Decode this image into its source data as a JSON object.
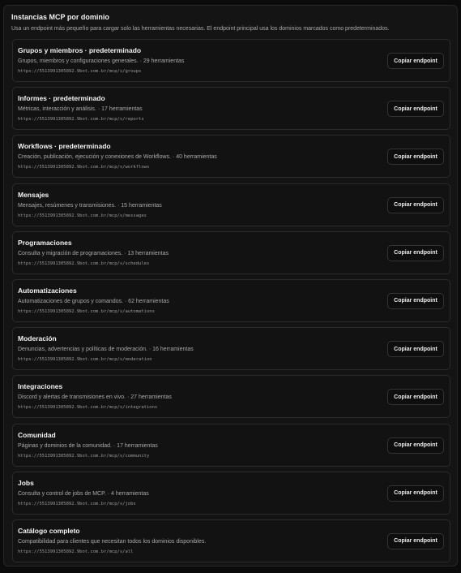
{
  "panel": {
    "title": "Instancias MCP por dominio",
    "subtitle": "Usa un endpoint más pequeño para cargar solo las herramientas necesarias. El endpoint principal usa los dominios marcados como predeterminados."
  },
  "copy_label": "Copiar endpoint",
  "instances": [
    {
      "title": "Grupos y miembros · predeterminado",
      "desc": "Grupos, miembros y configuraciones generales. · 29 herramientas",
      "url": "https://5513991305892.9bot.com.br/mcp/s/groups"
    },
    {
      "title": "Informes · predeterminado",
      "desc": "Métricas, interacción y análisis. · 17 herramientas",
      "url": "https://5513991305892.9bot.com.br/mcp/s/reports"
    },
    {
      "title": "Workflows · predeterminado",
      "desc": "Creación, publicación, ejecución y conexiones de Workflows. · 40 herramientas",
      "url": "https://5513991305892.9bot.com.br/mcp/s/workflows"
    },
    {
      "title": "Mensajes",
      "desc": "Mensajes, resúmenes y transmisiones. · 15 herramientas",
      "url": "https://5513991305892.9bot.com.br/mcp/s/messages"
    },
    {
      "title": "Programaciones",
      "desc": "Consulta y migración de programaciones. · 13 herramientas",
      "url": "https://5513991305892.9bot.com.br/mcp/s/schedules"
    },
    {
      "title": "Automatizaciones",
      "desc": "Automatizaciones de grupos y comandos. · 62 herramientas",
      "url": "https://5513991305892.9bot.com.br/mcp/s/automations"
    },
    {
      "title": "Moderación",
      "desc": "Denuncias, advertencias y políticas de moderación. · 16 herramientas",
      "url": "https://5513991305892.9bot.com.br/mcp/s/moderation"
    },
    {
      "title": "Integraciones",
      "desc": "Discord y alertas de transmisiones en vivo. · 27 herramientas",
      "url": "https://5513991305892.9bot.com.br/mcp/s/integrations"
    },
    {
      "title": "Comunidad",
      "desc": "Páginas y dominios de la comunidad. · 17 herramientas",
      "url": "https://5513991305892.9bot.com.br/mcp/s/community"
    },
    {
      "title": "Jobs",
      "desc": "Consulta y control de jobs de MCP. · 4 herramientas",
      "url": "https://5513991305892.9bot.com.br/mcp/s/jobs"
    },
    {
      "title": "Catálogo completo",
      "desc": "Compatibilidad para clientes que necesitan todos los dominios disponibles.",
      "url": "https://5513991305892.9bot.com.br/mcp/s/all"
    }
  ]
}
